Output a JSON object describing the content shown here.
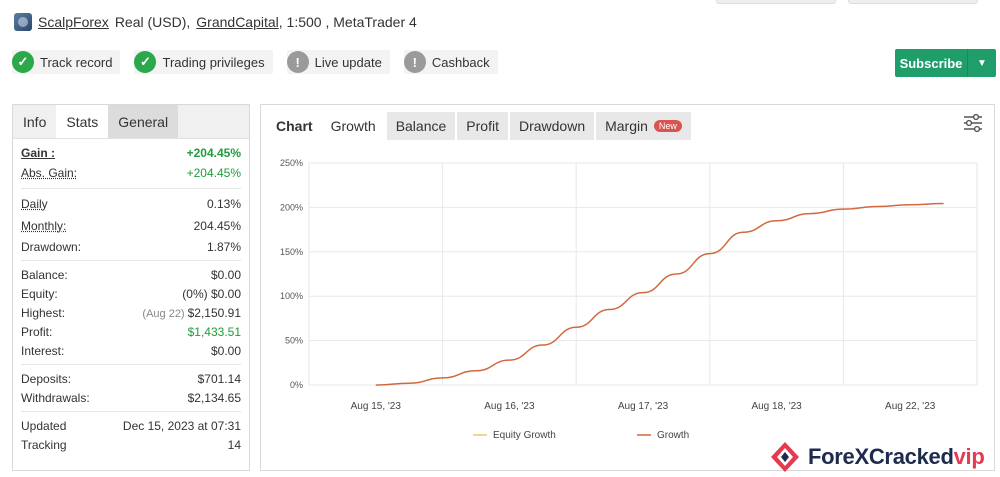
{
  "header": {
    "account_name": "ScalpForex",
    "account_type": "Real (USD),",
    "broker": "GrandCapital",
    "details": ", 1:500 , MetaTrader 4"
  },
  "badges": [
    {
      "label": "Track record",
      "status": "ok"
    },
    {
      "label": "Trading privileges",
      "status": "ok"
    },
    {
      "label": "Live update",
      "status": "warn"
    },
    {
      "label": "Cashback",
      "status": "warn"
    }
  ],
  "subscribe": {
    "label": "Subscribe"
  },
  "left_tabs": [
    "Info",
    "Stats",
    "General"
  ],
  "stats": {
    "gain": {
      "label": "Gain :",
      "value": "+204.45%"
    },
    "abs_gain": {
      "label": "Abs. Gain:",
      "value": "+204.45%"
    },
    "daily": {
      "label": "Daily",
      "value": "0.13%"
    },
    "monthly": {
      "label": "Monthly:",
      "value": "204.45%"
    },
    "drawdown": {
      "label": "Drawdown:",
      "value": "1.87%"
    },
    "balance": {
      "label": "Balance:",
      "value": "$0.00"
    },
    "equity": {
      "label": "Equity:",
      "pre": "(0%)",
      "value": "$0.00"
    },
    "highest": {
      "label": "Highest:",
      "pre": "(Aug 22)",
      "value": "$2,150.91"
    },
    "profit": {
      "label": "Profit:",
      "value": "$1,433.51"
    },
    "interest": {
      "label": "Interest:",
      "value": "$0.00"
    },
    "deposits": {
      "label": "Deposits:",
      "value": "$701.14"
    },
    "withdrawals": {
      "label": "Withdrawals:",
      "value": "$2,134.65"
    },
    "updated": {
      "label": "Updated",
      "value": "Dec 15, 2023 at 07:31"
    },
    "tracking": {
      "label": "Tracking",
      "value": "14"
    }
  },
  "chart_tabs": {
    "chart": "Chart",
    "growth": "Growth",
    "balance": "Balance",
    "profit": "Profit",
    "drawdown": "Drawdown",
    "margin": "Margin",
    "new_badge": "New"
  },
  "chart_data": {
    "type": "line",
    "x": [
      "Aug 15, '23",
      "Aug 16, '23",
      "Aug 17, '23",
      "Aug 18, '23",
      "Aug 22, '23"
    ],
    "yticks": [
      "0%",
      "50%",
      "100%",
      "150%",
      "200%",
      "250%"
    ],
    "ylim": [
      0,
      250
    ],
    "grid": true,
    "legend_position": "bottom",
    "series": [
      {
        "name": "Equity Growth",
        "color": "#f5c26b",
        "values": []
      },
      {
        "name": "Growth",
        "color": "#d2693f",
        "points": [
          [
            0,
            0
          ],
          [
            0.25,
            2
          ],
          [
            0.5,
            8
          ],
          [
            0.75,
            16
          ],
          [
            1.0,
            28
          ],
          [
            1.25,
            45
          ],
          [
            1.5,
            65
          ],
          [
            1.75,
            85
          ],
          [
            2.0,
            104
          ],
          [
            2.25,
            125
          ],
          [
            2.5,
            148
          ],
          [
            2.75,
            172
          ],
          [
            3.0,
            185
          ],
          [
            3.25,
            193
          ],
          [
            3.5,
            198
          ],
          [
            3.75,
            201
          ],
          [
            4.0,
            203
          ],
          [
            4.25,
            204.45
          ]
        ]
      }
    ]
  },
  "watermark": {
    "brand": "ForeXCracked",
    "suffix": "vip"
  }
}
